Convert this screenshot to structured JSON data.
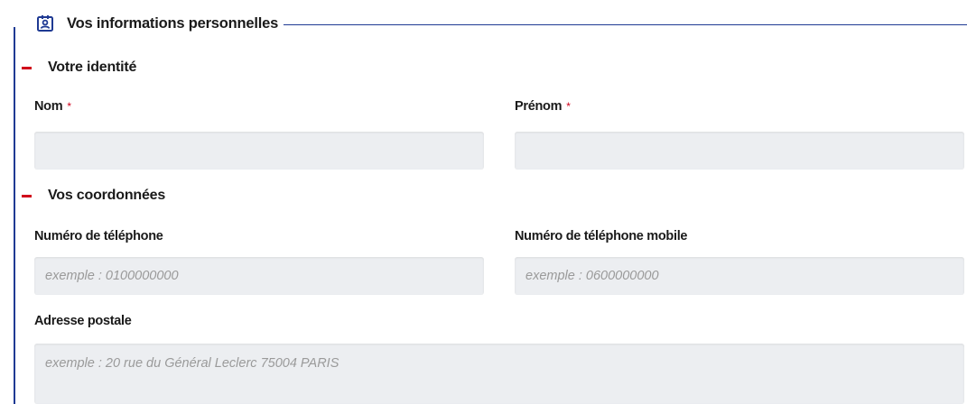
{
  "fieldset": {
    "title": "Vos informations personnelles",
    "icon": "contact-card-icon",
    "accent_color": "#1f3a93"
  },
  "sections": {
    "identity": {
      "title": "Votre identité"
    },
    "contact": {
      "title": "Vos coordonnées"
    }
  },
  "fields": {
    "nom": {
      "label": "Nom",
      "required_mark": "*",
      "value": "",
      "placeholder": ""
    },
    "prenom": {
      "label": "Prénom",
      "required_mark": "*",
      "value": "",
      "placeholder": ""
    },
    "telephone": {
      "label": "Numéro de téléphone",
      "value": "",
      "placeholder": "exemple : 0100000000"
    },
    "mobile": {
      "label": "Numéro de téléphone mobile",
      "value": "",
      "placeholder": "exemple : 0600000000"
    },
    "adresse": {
      "label": "Adresse postale",
      "value": "",
      "placeholder": "exemple : 20 rue du Général Leclerc 75004 PARIS"
    }
  },
  "colors": {
    "required": "#d0021b",
    "section_marker": "#d0021b",
    "input_background": "#eceef1"
  }
}
